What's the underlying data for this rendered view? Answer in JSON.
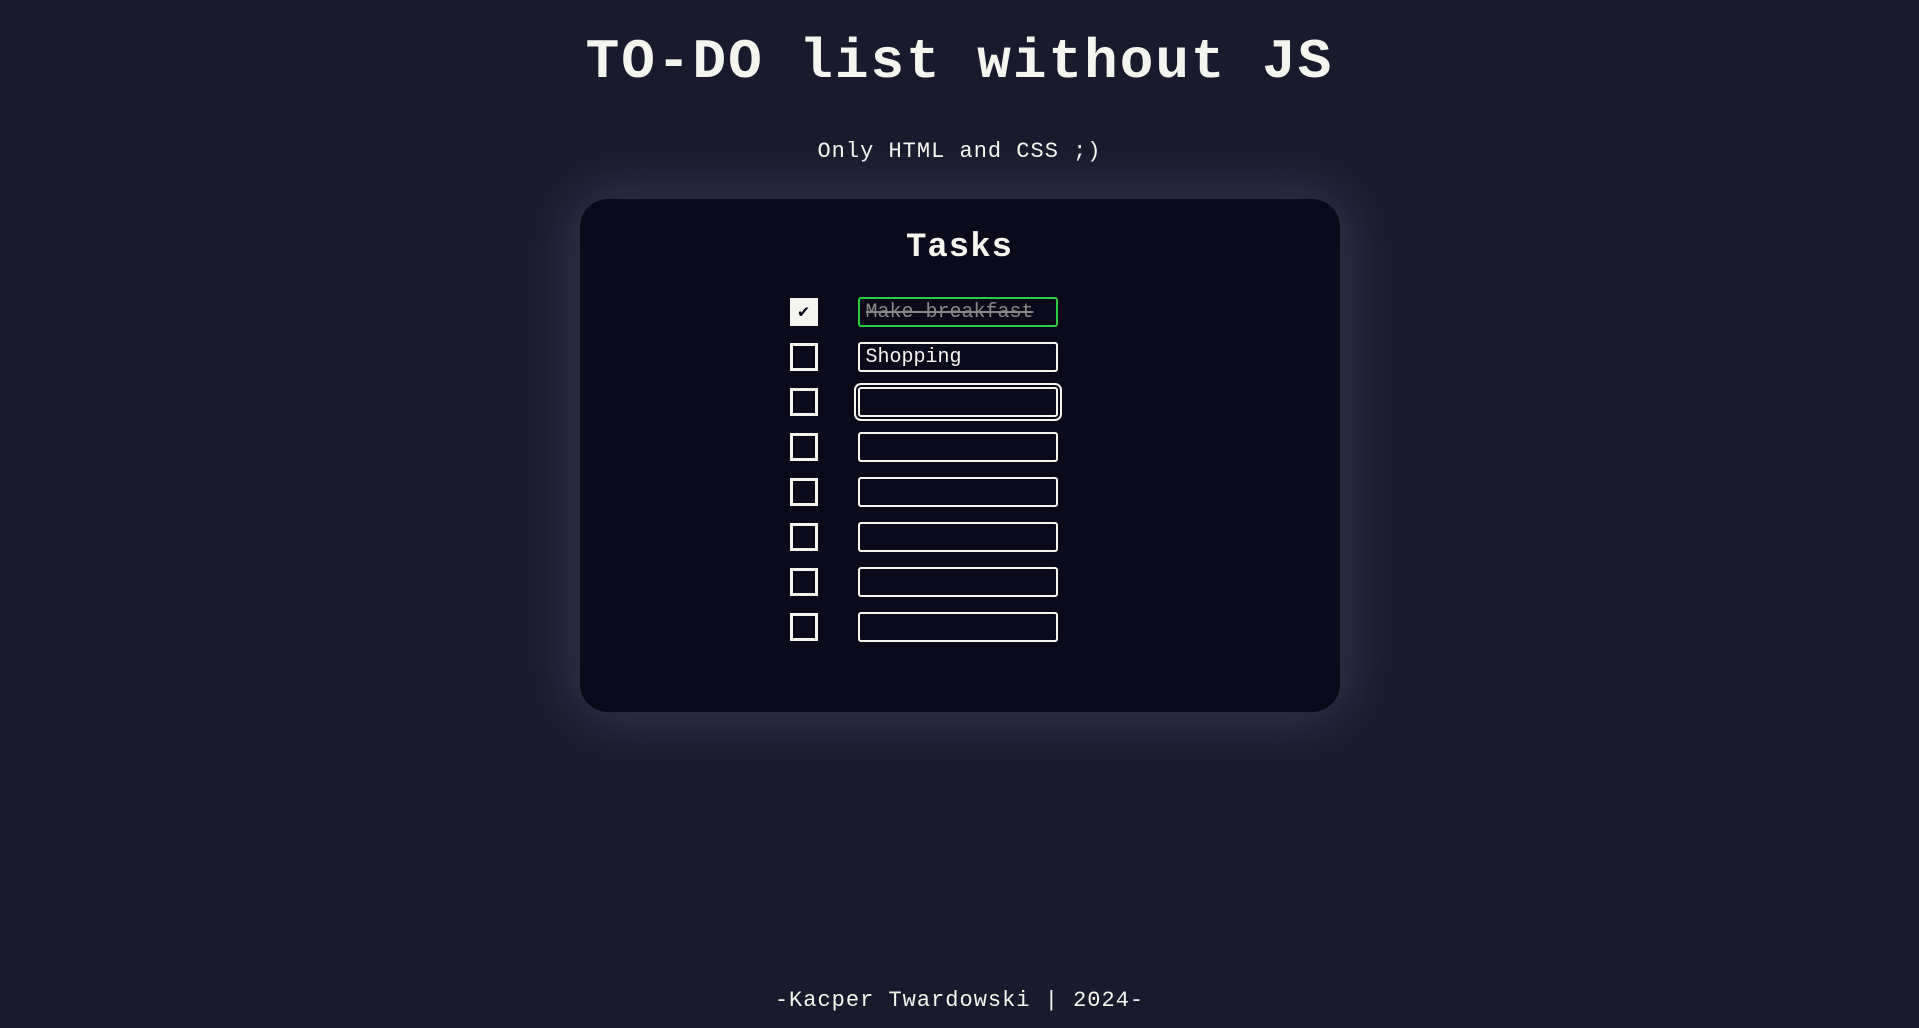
{
  "header": {
    "title": "TO-DO list without JS",
    "subtitle": "Only HTML and CSS ;)"
  },
  "card": {
    "heading": "Tasks",
    "tasks": [
      {
        "value": "Make breakfast",
        "checked": true,
        "focused": false
      },
      {
        "value": "Shopping",
        "checked": false,
        "focused": false
      },
      {
        "value": "",
        "checked": false,
        "focused": true
      },
      {
        "value": "",
        "checked": false,
        "focused": false
      },
      {
        "value": "",
        "checked": false,
        "focused": false
      },
      {
        "value": "",
        "checked": false,
        "focused": false
      },
      {
        "value": "",
        "checked": false,
        "focused": false
      },
      {
        "value": "",
        "checked": false,
        "focused": false
      }
    ]
  },
  "footer": {
    "text": "-Kacper Twardowski | 2024-"
  }
}
